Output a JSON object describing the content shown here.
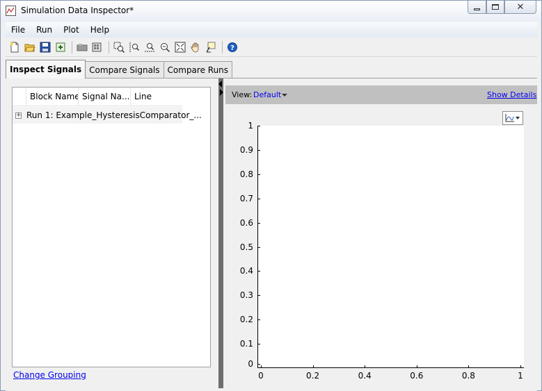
{
  "window": {
    "title": "Simulation Data Inspector*",
    "min_label": "▭",
    "max_label": "▢",
    "close_label": "✕"
  },
  "menu": {
    "items": [
      "File",
      "Run",
      "Plot",
      "Help"
    ]
  },
  "toolbar": {
    "icons": [
      "new-icon",
      "open-icon",
      "save-icon",
      "import-icon",
      "record-icon",
      "run-icon",
      "zoom-in-icon",
      "zoom-x-icon",
      "zoom-y-icon",
      "zoom-out-icon",
      "fit-icon",
      "pan-icon",
      "data-cursor-icon",
      "help-icon"
    ]
  },
  "tabs": [
    {
      "label": "Inspect Signals",
      "active": true
    },
    {
      "label": "Compare Signals",
      "active": false
    },
    {
      "label": "Compare Runs",
      "active": false
    }
  ],
  "signal_tree": {
    "columns": [
      "Block Name",
      "Signal Na...",
      "Line"
    ],
    "rows": [
      {
        "expander": "+",
        "label": "Run 1: Example_HysteresisComparator_..."
      }
    ]
  },
  "left_footer": {
    "change_grouping": "Change Grouping"
  },
  "view_bar": {
    "label": "View:",
    "value": "Default",
    "show_details": "Show Details"
  },
  "chart_data": {
    "type": "line",
    "series": [],
    "xlim": [
      0,
      1
    ],
    "ylim": [
      0,
      1
    ],
    "x_ticks": [
      "0",
      "0.2",
      "0.4",
      "0.6",
      "0.8",
      "1"
    ],
    "y_ticks": [
      "1",
      "0.9",
      "0.8",
      "0.7",
      "0.6",
      "0.5",
      "0.4",
      "0.3",
      "0.2",
      "0.1",
      "0"
    ],
    "grid": false
  }
}
